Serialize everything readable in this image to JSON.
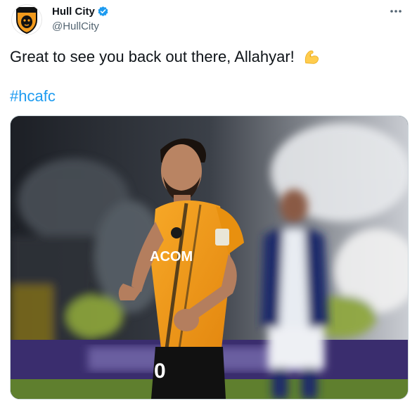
{
  "author": {
    "display_name": "Hull City",
    "handle": "@HullCity",
    "verified": true,
    "avatar_icon": "hull-city-crest-icon"
  },
  "tweet": {
    "text": "Great to see you back out there, Allahyar!",
    "emoji": "flexed-biceps",
    "hashtag": "#hcafc"
  },
  "menu_icon": "more-options-icon",
  "media": {
    "shirt_sponsor": "ACOM",
    "shorts_number": "0",
    "colors": {
      "shirt": "#f29a1c",
      "shorts": "#111111",
      "away_kit": "#1c2a6b",
      "hashtag": "#1d9bf0"
    }
  }
}
